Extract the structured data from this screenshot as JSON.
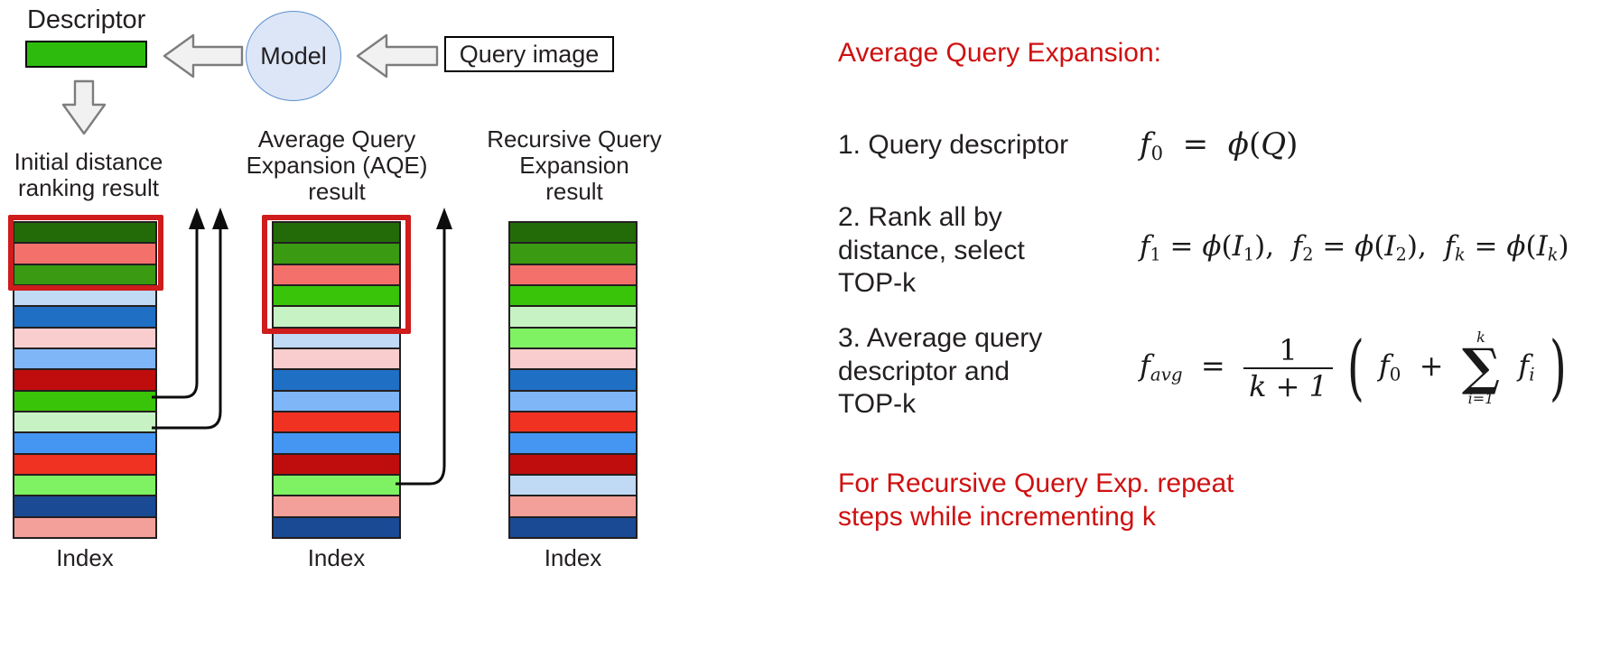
{
  "diagram": {
    "descriptor_label": "Descriptor",
    "model_label": "Model",
    "query_label": "Query image",
    "index_label": "Index",
    "columns": [
      {
        "id": "initial",
        "caption": "Initial distance\nranking result",
        "caption_line1": "Initial distance",
        "caption_line2": "ranking result",
        "index_label": "Index",
        "highlight_rows": 3,
        "bands": [
          "#236b09",
          "#f4706b",
          "#3a9a12",
          "#c0d9f4",
          "#1f6fc4",
          "#f9cdcd",
          "#7eb6f7",
          "#bf0d0d",
          "#39c409",
          "#c7f2c4",
          "#4596f2",
          "#f03223",
          "#7ef263",
          "#1a4a94",
          "#f4a09a"
        ]
      },
      {
        "id": "aqe",
        "caption_line1": "Average Query",
        "caption_line2": "Expansion (AQE)",
        "caption_line3": "result",
        "index_label": "Index",
        "highlight_rows": 5,
        "bands": [
          "#236b09",
          "#3a9a12",
          "#f4706b",
          "#39c409",
          "#c7f2c4",
          "#c0d9f4",
          "#f9cdcd",
          "#1f6fc4",
          "#7eb6f7",
          "#f03223",
          "#4596f2",
          "#bf0d0d",
          "#7ef263",
          "#f4a09a",
          "#1a4a94"
        ]
      },
      {
        "id": "recursive",
        "caption_line1": "Recursive Query",
        "caption_line2": "Expansion",
        "caption_line3": "result",
        "index_label": "Index",
        "highlight_rows": 0,
        "bands": [
          "#236b09",
          "#3a9a12",
          "#f4706b",
          "#39c409",
          "#c7f2c4",
          "#7ef263",
          "#f9cdcd",
          "#1f6fc4",
          "#7eb6f7",
          "#f03223",
          "#4596f2",
          "#bf0d0d",
          "#c0d9f4",
          "#f4a09a",
          "#1a4a94"
        ]
      }
    ],
    "colors": {
      "highlight_red": "#cf1c1c",
      "descriptor_green": "#2dbc0e",
      "model_fill": "#dce6f7",
      "model_stroke": "#5b8fd0",
      "text_red": "#cf1111",
      "outline": "#231f20"
    }
  },
  "panel": {
    "heading": "Average Query Expansion:",
    "steps": [
      {
        "number": "1.",
        "line1": "Query descriptor"
      },
      {
        "number": "2.",
        "line1": "Rank all by",
        "line2": "distance, select",
        "line3": "TOP-k"
      },
      {
        "number": "3.",
        "line1": "Average query",
        "line2": "descriptor and",
        "line3": "TOP-k"
      }
    ],
    "step1_text": "1. Query descriptor",
    "step2_line1": "2. Rank all by",
    "step2_line2": "distance, select",
    "step2_line3": "TOP-k",
    "step3_line1": "3. Average query",
    "step3_line2": "descriptor and",
    "step3_line3": "TOP-k",
    "footer_line1": "For Recursive Query Exp. repeat",
    "footer_line2": "steps while incrementing k",
    "formulas": {
      "f0": "f0 = ϕ(Q)",
      "fk": "f1 = ϕ(I1), f2 = ϕ(I2), fk = ϕ(Ik)",
      "favg": "favg = 1/(k+1) ( f0 + ∑ i=1..k fi )",
      "sum_upper": "k",
      "sum_lower": "i=1",
      "frac_num": "1",
      "frac_den": "k + 1"
    }
  }
}
